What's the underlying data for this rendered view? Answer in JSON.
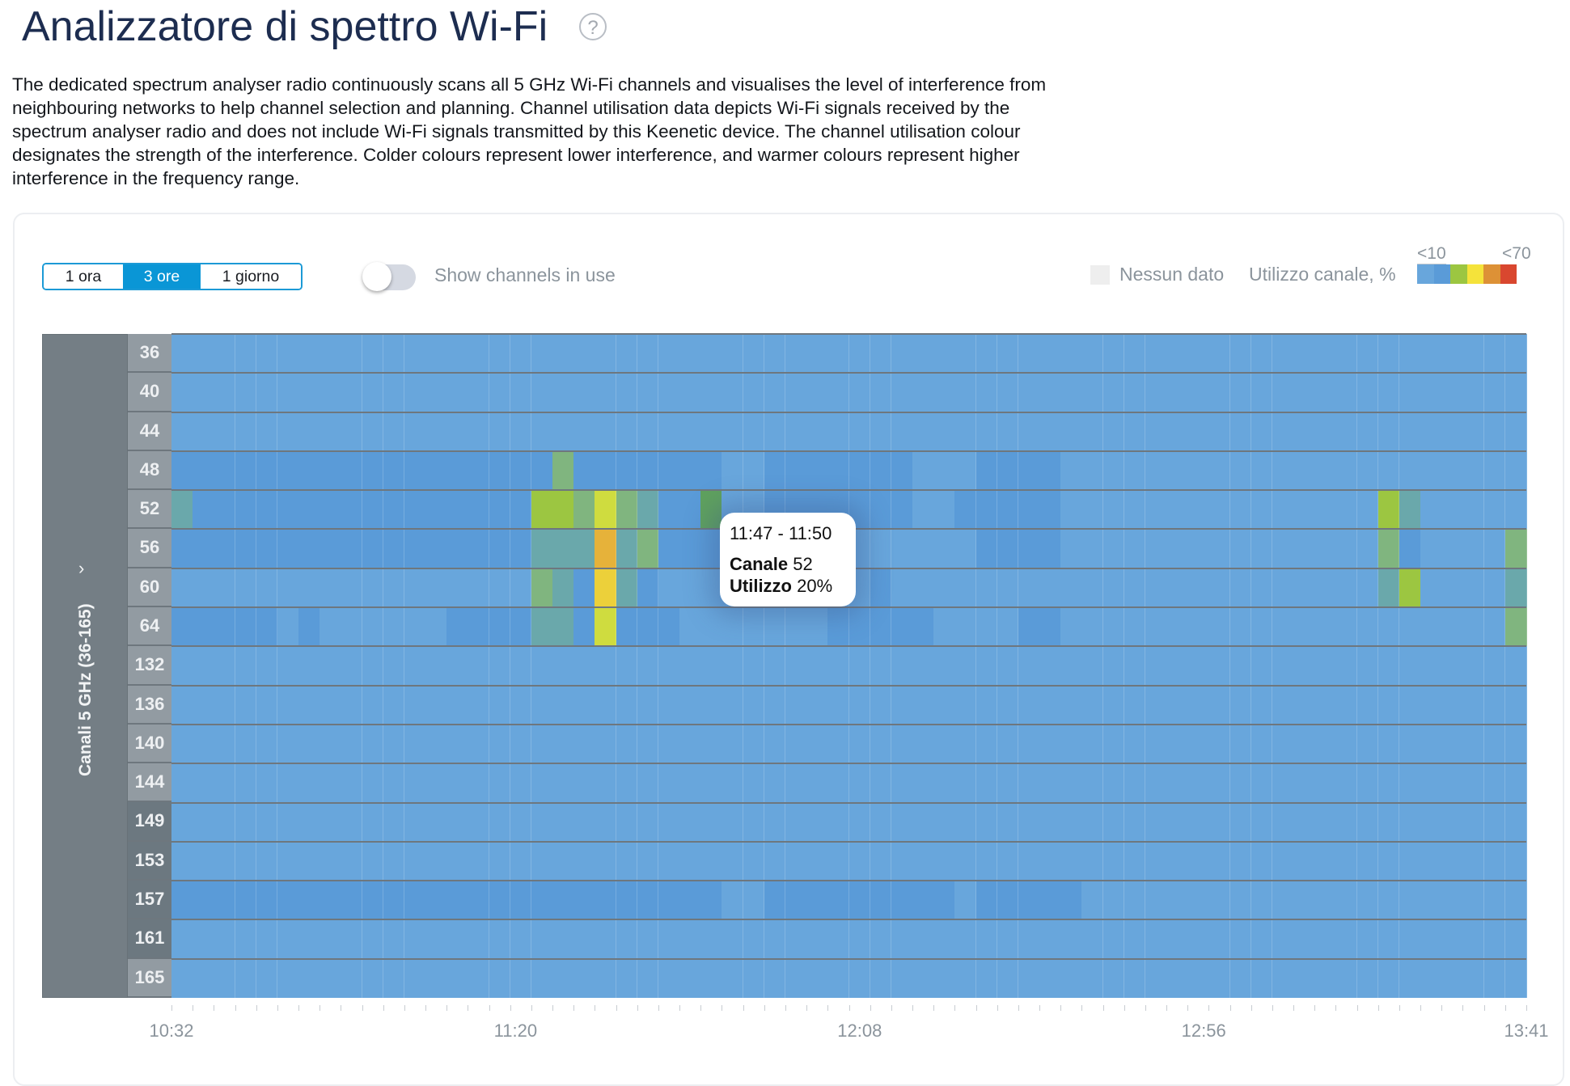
{
  "page": {
    "title": "Analizzatore di spettro Wi-Fi",
    "help_icon": "question-circle-icon",
    "help_glyph": "?",
    "description": "The dedicated spectrum analyser radio continuously scans all 5 GHz Wi-Fi channels and visualises the level of interference from neighbouring networks to help channel selection and planning. Channel utilisation data depicts Wi-Fi signals received by the spectrum analyser radio and does not include Wi-Fi signals transmitted by this Keenetic device. The channel utilisation colour designates the strength of the interference. Colder colours represent lower interference, and warmer colours represent higher interference in the frequency range."
  },
  "controls": {
    "range_buttons": [
      {
        "label": "1 ora",
        "selected": false
      },
      {
        "label": "3 ore",
        "selected": true
      },
      {
        "label": "1 giorno",
        "selected": false
      }
    ],
    "toggle_label": "Show channels in use",
    "toggle_on": false
  },
  "legend": {
    "no_data_label": "Nessun dato",
    "no_data_color": "#eeeeee",
    "utilization_label": "Utilizzo canale, %",
    "scale_low_label": "<10",
    "scale_high_label": "<70",
    "scale_colors": [
      "#68a6dc",
      "#5a9bd8",
      "#9cc641",
      "#f5e33a",
      "#dd9136",
      "#d9472f"
    ]
  },
  "band": {
    "label": "Canali 5 GHz (36-165)",
    "chevron_icon": "chevron-right-icon",
    "chevron_glyph": "›"
  },
  "tooltip": {
    "time": "11:47 - 11:50",
    "channel_label": "Canale",
    "channel_value": "52",
    "util_label": "Utilizzo",
    "util_value": "20%"
  },
  "chart_data": {
    "type": "heatmap",
    "title": "Utilizzo canale, %",
    "xlabel": "",
    "ylabel": "Canali 5 GHz (36-165)",
    "x_tick_labels": [
      "10:32",
      "11:20",
      "12:08",
      "12:56",
      "13:41"
    ],
    "x_range": [
      "10:32",
      "13:41"
    ],
    "interval_minutes": 3,
    "columns": 64,
    "channels": [
      "36",
      "40",
      "44",
      "48",
      "52",
      "56",
      "60",
      "64",
      "132",
      "136",
      "140",
      "144",
      "149",
      "153",
      "157",
      "161",
      "165"
    ],
    "dark_label_channels": [
      "149",
      "153",
      "157",
      "161"
    ],
    "level_legend": {
      "L": "<5",
      "D": "<10",
      "T": "~15",
      "G": "~20",
      "K": "~25",
      "Y": "~30",
      "Z": "~40",
      "W": "~50",
      "O": "~60"
    },
    "level_colors": {
      "L": "#68a6dc",
      "D": "#5a9bd8",
      "T": "#6aa8ab",
      "G": "#80b57f",
      "K": "#5fa15e",
      "Y": "#9cc641",
      "Z": "#cfdc3f",
      "W": "#ecd03a",
      "O": "#e6b23a"
    },
    "rows": {
      "36": "LLLLLLLLLLLLLLLLLLLLLLLLLLLLLLLLLLLLLLLLLLLLLLLLLLLLLLLLLLLLLLLL",
      "40": "LLLLLLLLLLLLLLLLLLLLLLLLLLLLLLLLLLLLLLLLLLLLLLLLLLLLLLLLLLLLLLLL",
      "44": "LLLLLLLLLLLLLLLLLLLLLLLLLLLLLLLLLLLLLLLLLLLLLLLLLLLLLLLLLLLLLLLL",
      "48": "DDDDDDDDDDDDDDDDDDGDDDDDDDLLDDDDDDDLLLDDDDLLLLLLLLLLLLLLLLLLLLLL",
      "52": "TDDDDDDDDDDDDDDDDYYGZGTDDKLLDDDDDDDLLDDDDDLLLLLLLLLLLLLLLYTLLLLL",
      "56": "DDDDDDDDDDDDDDDDDTTTOTGDDDDLDDLLLLLLLLDDDDLLLLLLLLLLLLLLLGDLLLLGD",
      "60": "LLLLLLLLLLLLLLLLLGTDWTDLLLLLLLLLLDLLLLLLLLLLLLLLLLLLLLLLLTYLLLLTD",
      "64": "DDDDDLDLLLLLLDDDDTTDZDDDLLLLLLLDDDDDLLLLDDLLLLLLLLLLLLLLLLLLLLLGD",
      "132": "LLLLLLLLLLLLLLLLLLLLLLLLLLLLLLLLLLLLLLLLLLLLLLLLLLLLLLLLLLLLLLLL",
      "136": "LLLLLLLLLLLLLLLLLLLLLLLLLLLLLLLLLLLLLLLLLLLLLLLLLLLLLLLLLLLLLLLL",
      "140": "LLLLLLLLLLLLLLLLLLLLLLLLLLLLLLLLLLLLLLLLLLLLLLLLLLLLLLLLLLLLLLLL",
      "144": "LLLLLLLLLLLLLLLLLLLLLLLLLLLLLLLLLLLLLLLLLLLLLLLLLLLLLLLLLLLLLLLL",
      "149": "LLLLLLLLLLLLLLLLLLLLLLLLLLLLLLLLLLLLLLLLLLLLLLLLLLLLLLLLLLLLLLLL",
      "153": "LLLLLLLLLLLLLLLLLLLLLLLLLLLLLLLLLLLLLLLLLLLLLLLLLLLLLLLLLLLLLLLL",
      "157": "DDDDDDDDDDDDDDDDDDDDDDDDDDLLDDDDDDDDDLDDDDDLLLLLLLLLLLLLLLLLLLLL",
      "161": "LLLLLLLLLLLLLLLLLLLLLLLLLLLLLLLLLLLLLLLLLLLLLLLLLLLLLLLLLLLLLLLL",
      "165": "LLLLLLLLLLLLLLLLLLLLLLLLLLLLLLLLLLLLLLLLLLLLLLLLLLLLLLLLLLLLLLLL"
    },
    "highlighted_cell": {
      "channel": "52",
      "time": "11:47 - 11:50",
      "utilization_percent": 20
    }
  }
}
